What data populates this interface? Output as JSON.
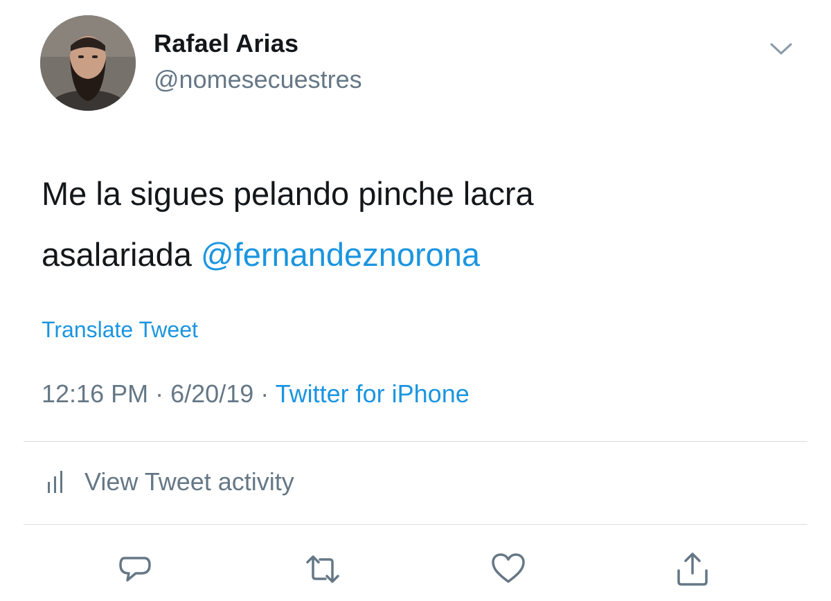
{
  "tweet": {
    "author": {
      "display_name": "Rafael Arias",
      "handle": "@nomesecuestres"
    },
    "text": {
      "line1": "Me la sigues pelando pinche lacra",
      "line2_prefix": "asalariada ",
      "mention": "@fernandeznorona"
    },
    "translate_label": "Translate Tweet",
    "time": "12:16 PM",
    "separator": "·",
    "date": "6/20/19",
    "source": "Twitter for iPhone"
  },
  "activity": {
    "label": "View Tweet activity",
    "icon": "bar-chart-icon"
  },
  "actions": [
    {
      "name": "reply",
      "icon": "reply-icon"
    },
    {
      "name": "retweet",
      "icon": "retweet-icon"
    },
    {
      "name": "like",
      "icon": "heart-icon"
    },
    {
      "name": "share",
      "icon": "share-icon"
    }
  ],
  "colors": {
    "link": "#1b95e0",
    "secondary_text": "#657786",
    "primary_text": "#14171a",
    "divider": "#d9dde1"
  }
}
